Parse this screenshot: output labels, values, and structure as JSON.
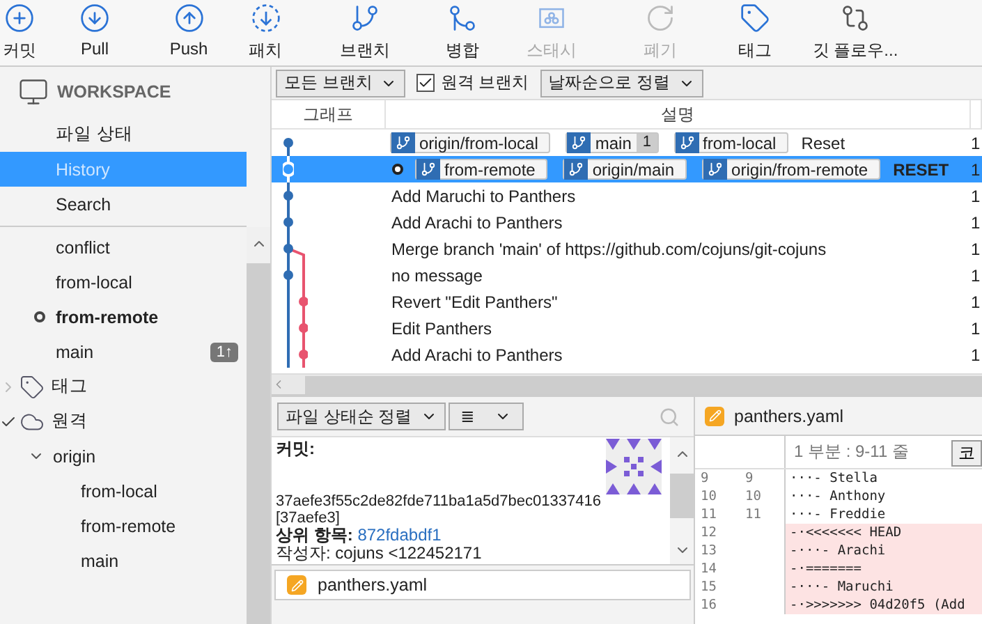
{
  "toolbar": [
    {
      "label": "커밋",
      "kind": "commit",
      "disabled": false
    },
    {
      "label": "Pull",
      "kind": "pull",
      "disabled": false
    },
    {
      "label": "Push",
      "kind": "push",
      "disabled": false
    },
    {
      "label": "패치",
      "kind": "fetch",
      "disabled": false
    },
    {
      "label": "브랜치",
      "kind": "branch",
      "disabled": false
    },
    {
      "label": "병합",
      "kind": "merge",
      "disabled": false
    },
    {
      "label": "스태시",
      "kind": "stash",
      "disabled": true
    },
    {
      "label": "폐기",
      "kind": "discard",
      "disabled": true
    },
    {
      "label": "태그",
      "kind": "tag",
      "disabled": false
    },
    {
      "label": "깃 플로우...",
      "kind": "flow",
      "disabled": false
    }
  ],
  "sidebar": {
    "workspace": {
      "title": "WORKSPACE",
      "items": [
        {
          "label": "파일 상태",
          "selected": false
        },
        {
          "label": "History",
          "selected": true
        },
        {
          "label": "Search",
          "selected": false
        }
      ]
    },
    "branches": [
      {
        "label": "conflict",
        "current": false
      },
      {
        "label": "from-local",
        "current": false
      },
      {
        "label": "from-remote",
        "current": true
      },
      {
        "label": "main",
        "current": false,
        "badge": "1↑"
      }
    ],
    "groups": [
      {
        "label": "태그",
        "kind": "tag",
        "expanded": false
      },
      {
        "label": "원격",
        "kind": "remote",
        "expanded": true,
        "children": [
          {
            "label": "origin",
            "expanded": true,
            "children": [
              {
                "label": "from-local"
              },
              {
                "label": "from-remote"
              },
              {
                "label": "main"
              }
            ]
          }
        ]
      }
    ]
  },
  "filters": {
    "branches": "모든 브랜치",
    "remote": {
      "label": "원격 브랜치",
      "checked": true
    },
    "sort": "날짜순으로 정렬"
  },
  "history": {
    "columns": [
      "그래프",
      "설명"
    ],
    "rows": [
      {
        "kind": "commit",
        "selected": false,
        "current": false,
        "refs": [
          {
            "name": "origin/from-local"
          },
          {
            "name": "main",
            "count": "1"
          },
          {
            "name": "from-local"
          }
        ],
        "message": "Reset",
        "column_3": "1"
      },
      {
        "kind": "head",
        "selected": true,
        "current": true,
        "refs": [
          {
            "name": "from-remote"
          },
          {
            "name": "origin/main"
          },
          {
            "name": "origin/from-remote"
          }
        ],
        "message": "RESET",
        "column_3": "1"
      },
      {
        "kind": "commit",
        "selected": false,
        "current": false,
        "refs": [],
        "message": "Add Maruchi to Panthers",
        "column_3": "1"
      },
      {
        "kind": "commit",
        "selected": false,
        "current": false,
        "refs": [],
        "message": "Add Arachi to Panthers",
        "column_3": "1"
      },
      {
        "kind": "merge",
        "selected": false,
        "current": false,
        "refs": [],
        "message": "Merge branch 'main' of https://github.com/cojuns/git-cojuns",
        "column_3": "1"
      },
      {
        "kind": "commit",
        "selected": false,
        "current": false,
        "refs": [],
        "message": "no message",
        "column_3": "1"
      },
      {
        "kind": "side",
        "selected": false,
        "current": false,
        "refs": [],
        "message": "Revert \"Edit Panthers\"",
        "column_3": "1"
      },
      {
        "kind": "side",
        "selected": false,
        "current": false,
        "refs": [],
        "message": "Edit Panthers",
        "column_3": "1"
      },
      {
        "kind": "side",
        "selected": false,
        "current": false,
        "refs": [],
        "message": "Add Arachi to Panthers",
        "column_3": "1"
      }
    ]
  },
  "details": {
    "sort": "파일 상태순 정렬",
    "view": "≣",
    "commit_label": "커밋:",
    "hash": "37aefe3f55c2de82fde711ba1a5d7bec01337416 [37aefe3]",
    "parent_label": "상위 항목:",
    "parent": "872fdabdf1",
    "author": "작성자: cojuns <122452171",
    "files": [
      {
        "name": "panthers.yaml"
      }
    ]
  },
  "diff": {
    "file": "panthers.yaml",
    "hunk": "1 부분 : 9-11 줄",
    "button": "코",
    "lines": [
      {
        "old": "9",
        "new": "9",
        "text": "···- Stella",
        "kind": "context"
      },
      {
        "old": "10",
        "new": "10",
        "text": "···- Anthony",
        "kind": "context"
      },
      {
        "old": "11",
        "new": "11",
        "text": "···- Freddie",
        "kind": "context"
      },
      {
        "old": "12",
        "text": "-·<<<<<<< HEAD",
        "kind": "removed"
      },
      {
        "old": "13",
        "text": "-···- Arachi",
        "kind": "removed"
      },
      {
        "old": "14",
        "text": "-·=======",
        "kind": "removed"
      },
      {
        "old": "15",
        "text": "-···- Maruchi",
        "kind": "removed"
      },
      {
        "old": "16",
        "text": "-·>>>>>>> 04d20f5 (Add",
        "kind": "removed"
      }
    ]
  }
}
